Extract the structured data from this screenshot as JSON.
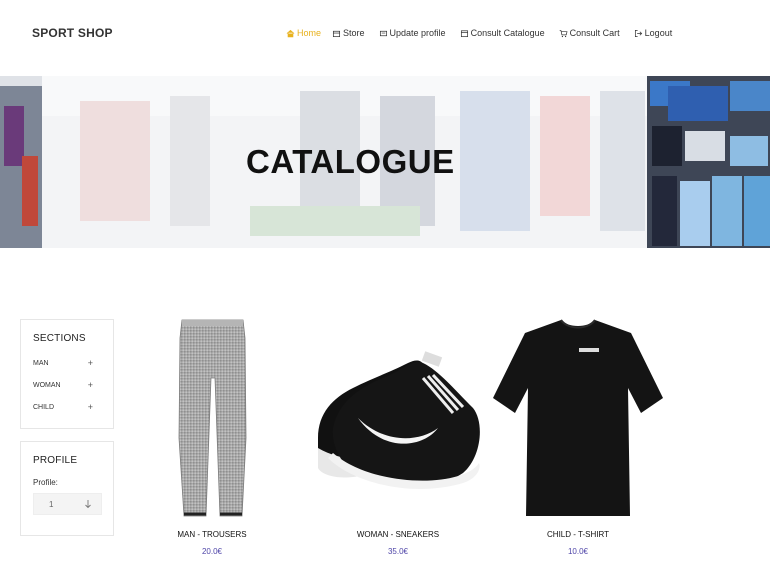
{
  "header": {
    "brand": "SPORT SHOP",
    "nav": [
      {
        "label": "Home",
        "icon": "home-icon",
        "active": true
      },
      {
        "label": "Store",
        "icon": "store-icon"
      },
      {
        "label": "Update profile",
        "icon": "profile-icon"
      },
      {
        "label": "Consult Catalogue",
        "icon": "catalogue-icon"
      },
      {
        "label": "Consult Cart",
        "icon": "cart-icon"
      },
      {
        "label": "Logout",
        "icon": "logout-icon"
      }
    ],
    "active_color": "#e8b21e"
  },
  "hero": {
    "title": "CATALOGUE"
  },
  "sidebar": {
    "sections": {
      "title": "SECTIONS",
      "items": [
        {
          "label": "MAN",
          "toggle": "+"
        },
        {
          "label": "WOMAN",
          "toggle": "+"
        },
        {
          "label": "CHILD",
          "toggle": "+"
        }
      ]
    },
    "profile": {
      "title": "PROFILE",
      "label": "Profile:",
      "value": "1"
    }
  },
  "products": [
    {
      "name": "MAN - TROUSERS",
      "price": "20.0€",
      "image": "trousers"
    },
    {
      "name": "WOMAN - SNEAKERS",
      "price": "35.0€",
      "image": "sneakers"
    },
    {
      "name": "CHILD - T-SHIRT",
      "price": "10.0€",
      "image": "tshirt"
    }
  ],
  "price_color": "#4f45a8"
}
